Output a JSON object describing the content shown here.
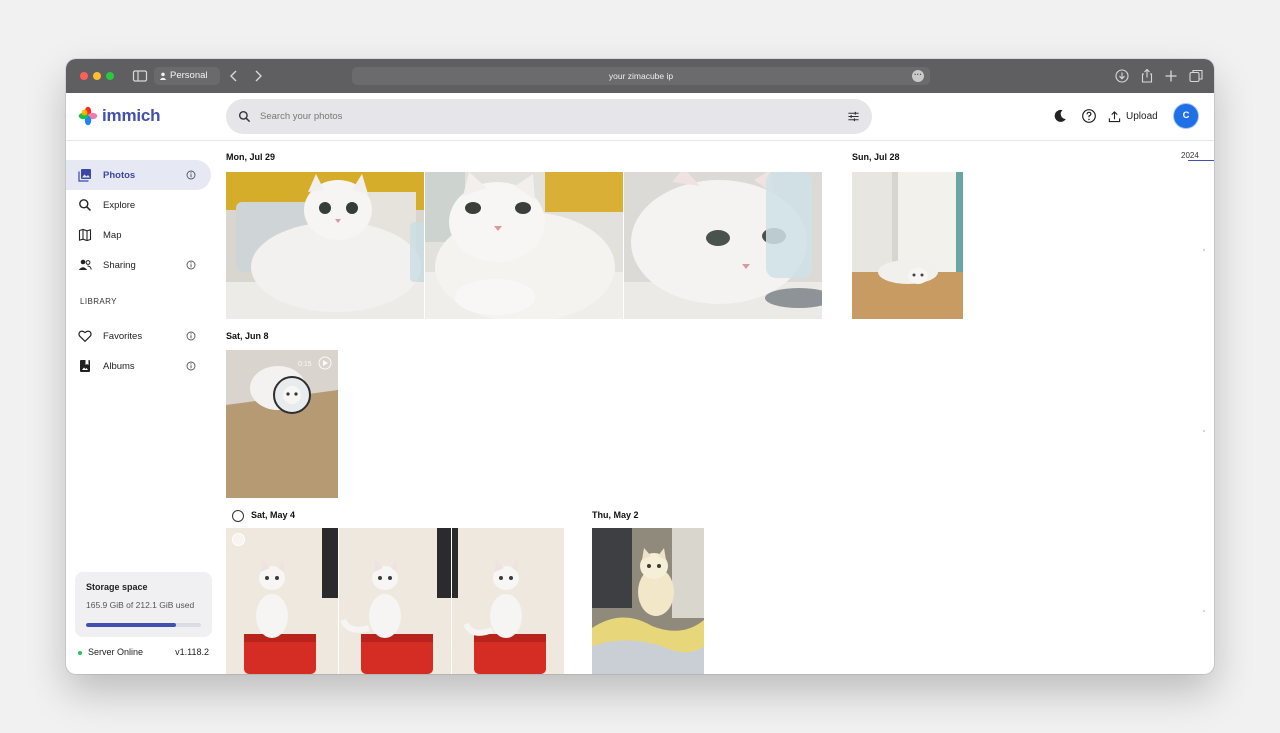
{
  "browser": {
    "profile": "Personal",
    "url": "your zimacube ip"
  },
  "header": {
    "app_name": "immich",
    "search_placeholder": "Search your photos",
    "upload_label": "Upload",
    "avatar_initial": "C"
  },
  "sidebar": {
    "items": [
      {
        "label": "Photos",
        "icon": "photos-icon",
        "active": true
      },
      {
        "label": "Explore",
        "icon": "search-icon"
      },
      {
        "label": "Map",
        "icon": "map-icon"
      },
      {
        "label": "Sharing",
        "icon": "people-icon"
      }
    ],
    "library_heading": "LIBRARY",
    "library_items": [
      {
        "label": "Favorites",
        "icon": "heart-icon"
      },
      {
        "label": "Albums",
        "icon": "album-icon"
      }
    ],
    "storage": {
      "title": "Storage space",
      "used_text": "165.9 GiB of 212.1 GiB used",
      "used_fraction": 0.78
    },
    "server": {
      "status": "Server Online",
      "version": "v1.118.2"
    }
  },
  "timeline": {
    "groups": [
      {
        "date": "Mon, Jul 29"
      },
      {
        "date": "Sun, Jul 28"
      },
      {
        "date": "Sat, Jun 8"
      },
      {
        "date": "Sat, May 4"
      },
      {
        "date": "Thu, May 2"
      }
    ],
    "year": "2024"
  },
  "colors": {
    "accent": "#4250af",
    "chrome": "#5f5f61",
    "online": "#22c55e"
  }
}
